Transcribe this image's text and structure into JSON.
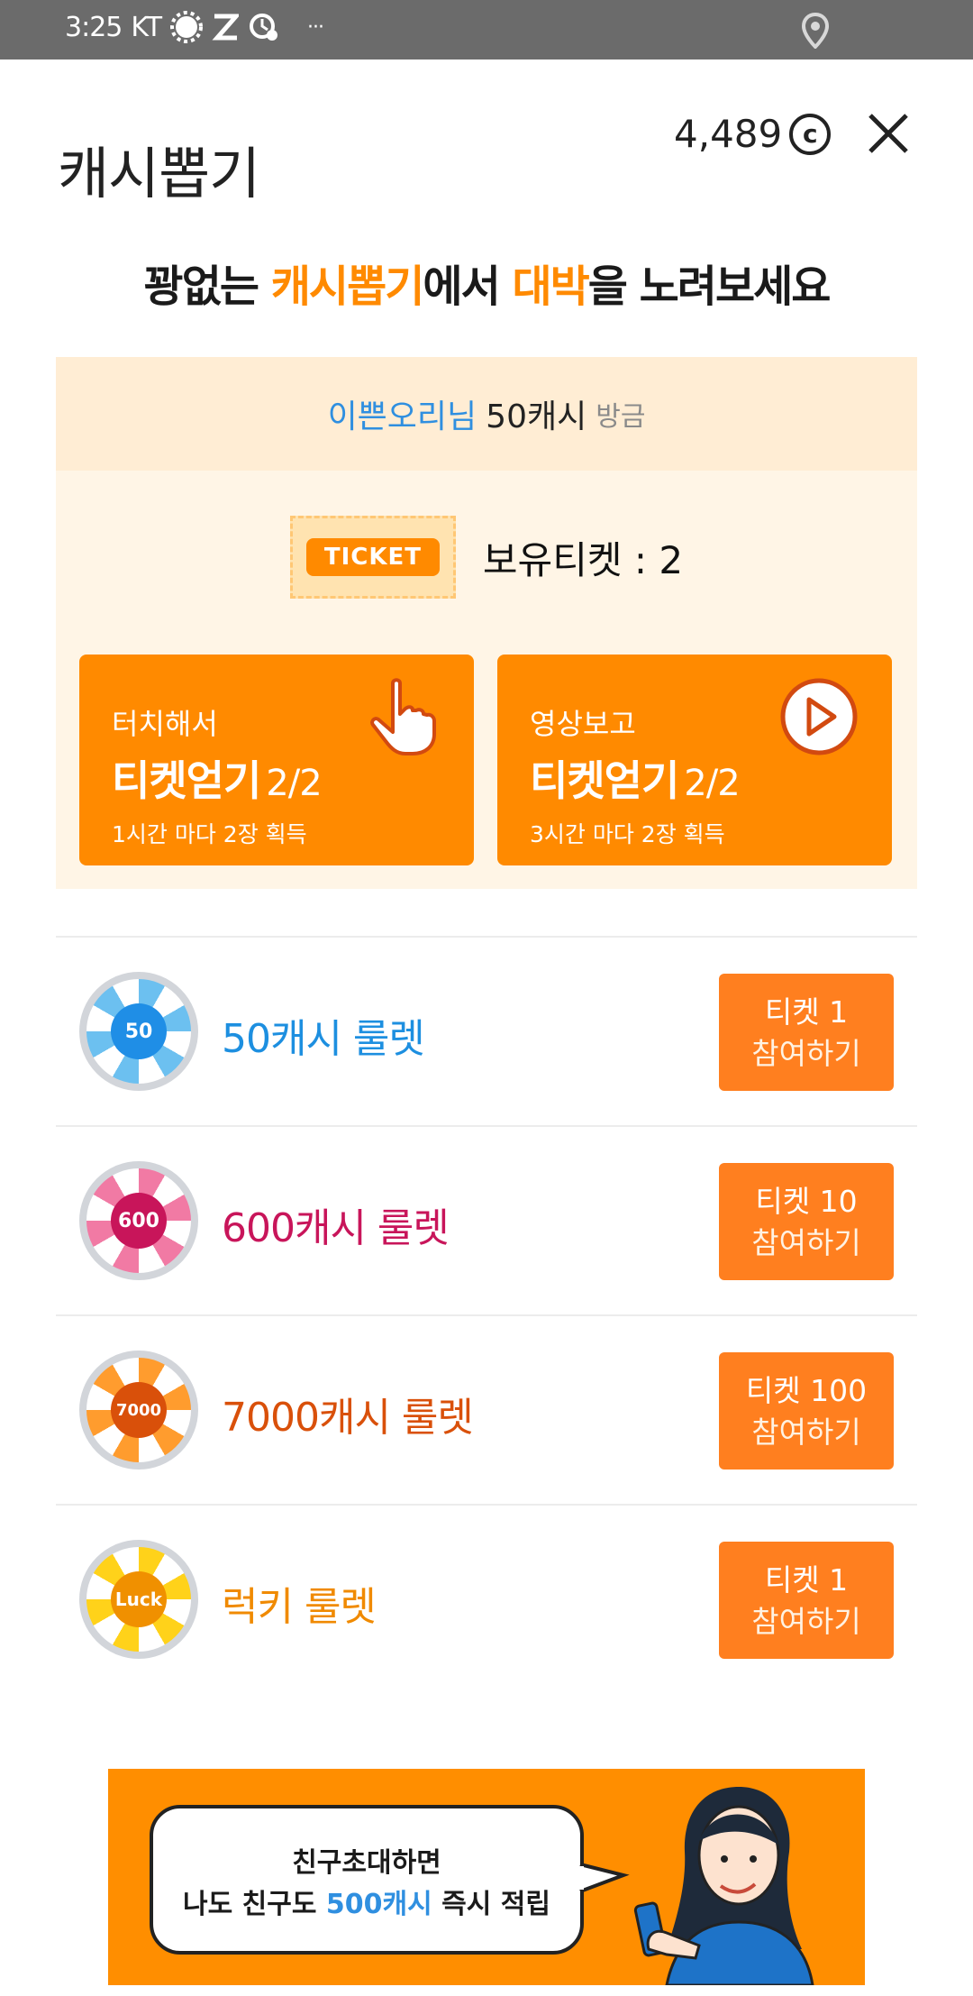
{
  "status_bar": {
    "time": "3:25",
    "carrier": "KT",
    "more": "···"
  },
  "header": {
    "title": "캐시뽑기",
    "balance": "4,489",
    "coin_symbol": "c"
  },
  "headline": {
    "part1": "꽝없는 ",
    "hl1": "캐시뽑기",
    "part2": "에서 ",
    "hl2": "대박",
    "part3": "을 노려보세요"
  },
  "notice": {
    "nickname": "이쁜오리님",
    "amount": "50캐시",
    "when": "방금"
  },
  "ticket": {
    "tag": "TICKET",
    "count_label": "보유티켓 : 2"
  },
  "actions": [
    {
      "top": "터치해서",
      "main": "티켓얻기",
      "fraction": "2/2",
      "note": "1시간 마다 2장 획득",
      "icon": "hand-pointer-icon"
    },
    {
      "top": "영상보고",
      "main": "티켓얻기",
      "fraction": "2/2",
      "note": "3시간 마다 2장 획득",
      "icon": "play-icon"
    }
  ],
  "roulettes": [
    {
      "hub": "50",
      "name": "50캐시 룰렛",
      "ticket": "티켓 1",
      "join": "참여하기",
      "color": "#1d8fe0",
      "wheel_light": "#6cc0f0",
      "hub_color": "#1f8ee6"
    },
    {
      "hub": "600",
      "name": "600캐시 룰렛",
      "ticket": "티켓 10",
      "join": "참여하기",
      "color": "#c8155a",
      "wheel_light": "#f17aa4",
      "hub_color": "#c8155a"
    },
    {
      "hub": "7000",
      "name": "7000캐시 룰렛",
      "ticket": "티켓 100",
      "join": "참여하기",
      "color": "#d9500a",
      "wheel_light": "#ff9c2e",
      "hub_color": "#d9500a"
    },
    {
      "hub": "Luck",
      "name": "럭키 룰렛",
      "ticket": "티켓 1",
      "join": "참여하기",
      "color": "#f08a00",
      "wheel_light": "#ffd21a",
      "hub_color": "#f09000"
    }
  ],
  "banner": {
    "line1": "친구초대하면",
    "line2a": "나도 친구도 ",
    "line2b": "500캐시",
    "line2c": " 즉시 적립"
  }
}
